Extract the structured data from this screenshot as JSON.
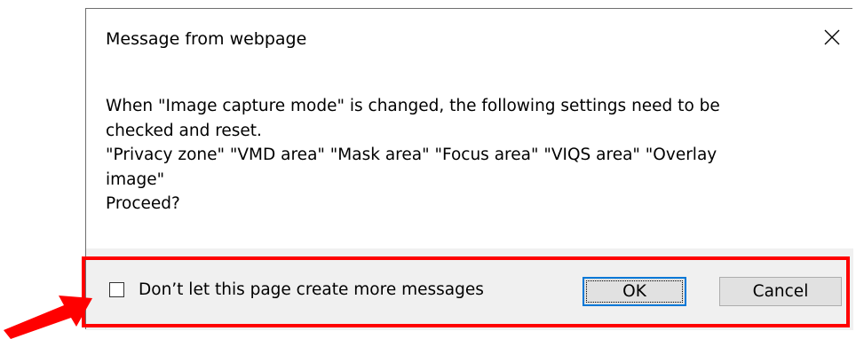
{
  "dialog": {
    "title": "Message from webpage",
    "close_icon": "close-icon",
    "message_lines": [
      "When \"Image capture mode\" is changed, the following settings need to be",
      "checked and reset.",
      "\"Privacy zone\" \"VMD area\" \"Mask area\" \"Focus area\" \"VIQS area\" \"Overlay",
      "image\"",
      "Proceed?"
    ],
    "checkbox": {
      "label": "Don’t let this page create more messages",
      "checked": false
    },
    "buttons": {
      "ok_label": "OK",
      "cancel_label": "Cancel"
    }
  },
  "annotation": {
    "highlight_color": "#ff0000",
    "arrow_icon": "red-arrow-icon"
  },
  "colors": {
    "footer_bg": "#f0f0f0",
    "focus_border": "#0078d7",
    "button_bg": "#e1e1e1"
  }
}
